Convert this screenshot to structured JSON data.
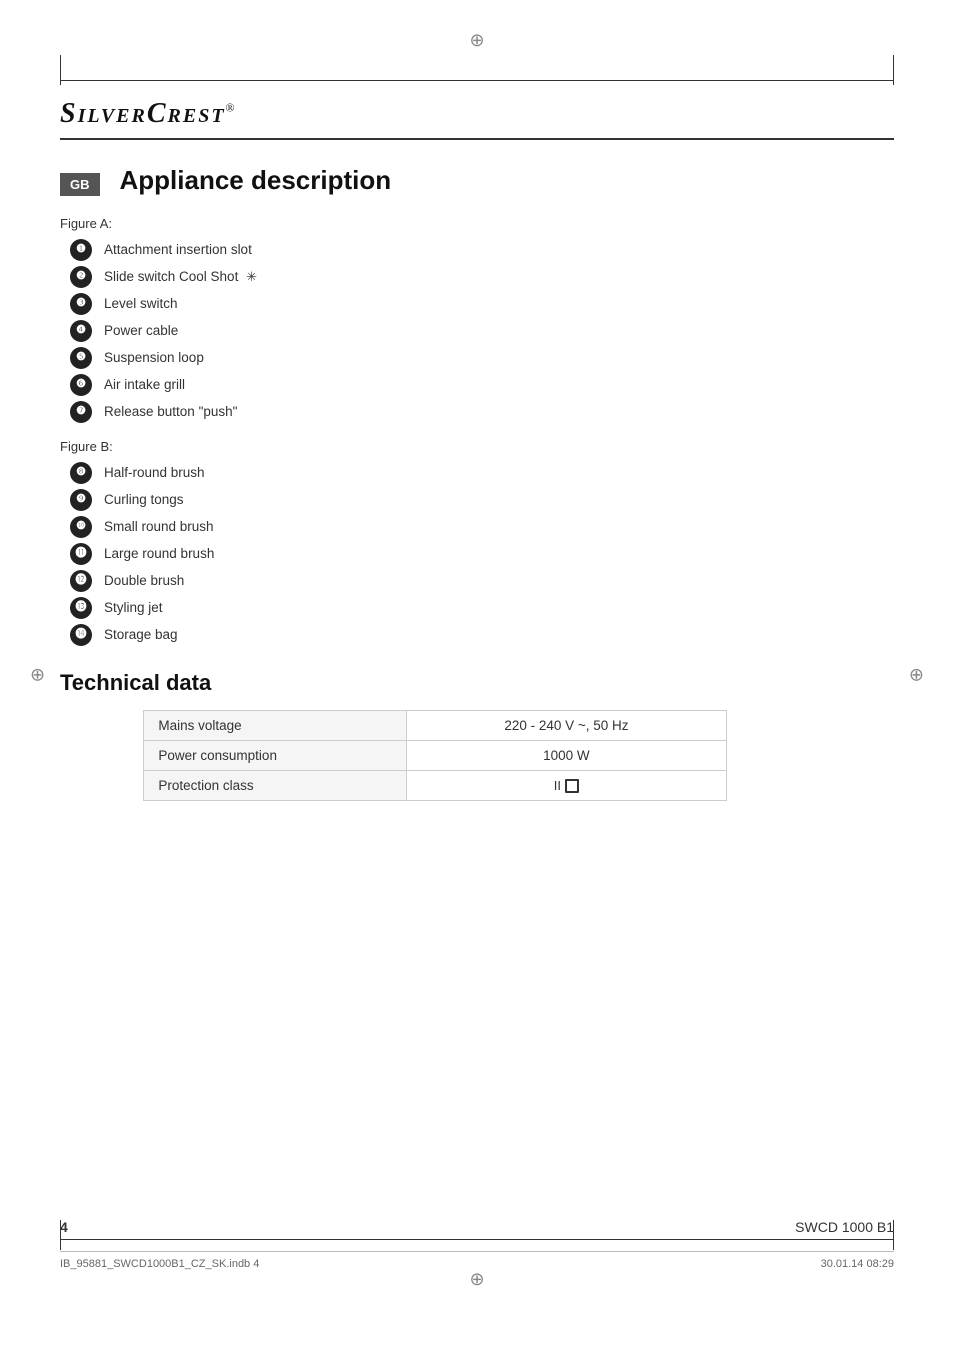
{
  "brand": {
    "name": "SilverCrest",
    "registered": "®"
  },
  "page": {
    "number": "4",
    "model": "SWCD 1000 B1",
    "file_info": "IB_95881_SWCD1000B1_CZ_SK.indb   4",
    "date_info": "30.01.14   08:29"
  },
  "section_appliance": {
    "heading": "Appliance description",
    "figure_a_label": "Figure A:",
    "figure_a_items": [
      {
        "number": "1",
        "text": "Attachment insertion slot"
      },
      {
        "number": "2",
        "text": "Slide switch Cool Shot",
        "has_icon": true
      },
      {
        "number": "3",
        "text": "Level switch"
      },
      {
        "number": "4",
        "text": "Power cable"
      },
      {
        "number": "5",
        "text": "Suspension loop"
      },
      {
        "number": "6",
        "text": "Air intake grill"
      },
      {
        "number": "7",
        "text": "Release button \"push\""
      }
    ],
    "figure_b_label": "Figure B:",
    "figure_b_items": [
      {
        "number": "8",
        "text": "Half-round brush"
      },
      {
        "number": "9",
        "text": "Curling tongs"
      },
      {
        "number": "10",
        "text": "Small round brush"
      },
      {
        "number": "11",
        "text": "Large round brush"
      },
      {
        "number": "12",
        "text": "Double brush"
      },
      {
        "number": "13",
        "text": "Styling jet"
      },
      {
        "number": "14",
        "text": "Storage bag"
      }
    ]
  },
  "section_technical": {
    "heading": "Technical data",
    "rows": [
      {
        "label": "Mains voltage",
        "value": "220 - 240 V ~, 50 Hz"
      },
      {
        "label": "Power consumption",
        "value": "1000 W"
      },
      {
        "label": "Protection class",
        "value": "II □",
        "is_symbol": true
      }
    ]
  },
  "gb_badge": "GB"
}
